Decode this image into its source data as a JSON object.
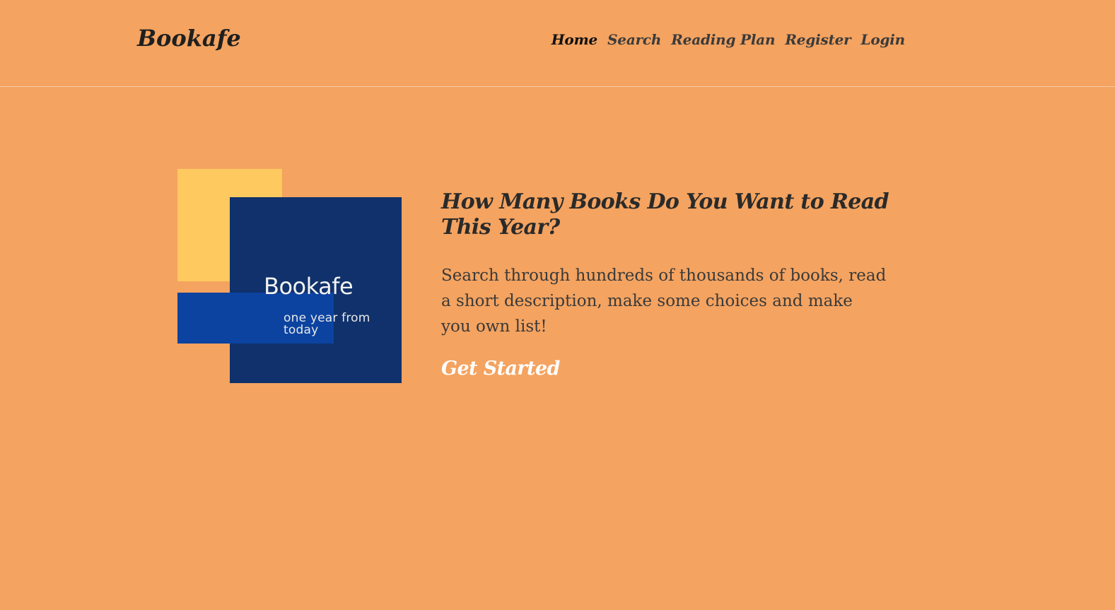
{
  "header": {
    "brand": "Bookafe",
    "nav": [
      {
        "label": "Home",
        "active": true
      },
      {
        "label": "Search",
        "active": false
      },
      {
        "label": "Reading Plan",
        "active": false
      },
      {
        "label": "Register",
        "active": false
      },
      {
        "label": "Login",
        "active": false
      }
    ]
  },
  "logo": {
    "title": "Bookafe",
    "tagline": "one year from today"
  },
  "hero": {
    "title": "How Many Books Do You Want to Read This Year?",
    "description": "Search through hundreds of thousands of books, read a short description, make some choices and make you own list!",
    "cta_label": "Get Started"
  },
  "colors": {
    "background": "#f4a360",
    "yellow": "#fec95f",
    "navy": "#10316b",
    "blue": "#0c43a0",
    "text_dark": "#2a2a2a",
    "cta_text": "#ffffff"
  }
}
